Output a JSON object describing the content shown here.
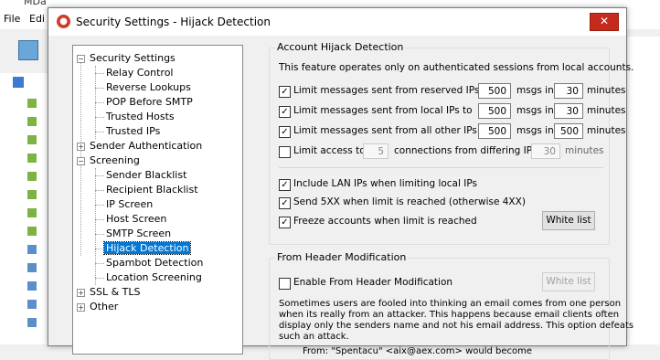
{
  "background": {
    "title": "MDa",
    "menu": [
      "File",
      "Edi"
    ]
  },
  "dialog": {
    "title": "Security Settings - Hijack Detection",
    "close_glyph": "✕"
  },
  "tree": {
    "security_settings": "Security Settings",
    "relay_control": "Relay Control",
    "reverse_lookups": "Reverse Lookups",
    "pop_before_smtp": "POP Before SMTP",
    "trusted_hosts": "Trusted Hosts",
    "trusted_ips": "Trusted IPs",
    "sender_auth": "Sender Authentication",
    "screening": "Screening",
    "sender_blacklist": "Sender Blacklist",
    "recipient_blacklist": "Recipient Blacklist",
    "ip_screen": "IP Screen",
    "host_screen": "Host Screen",
    "smtp_screen": "SMTP Screen",
    "hijack_detection": "Hijack Detection",
    "spambot_detection": "Spambot Detection",
    "location_screening": "Location Screening",
    "ssl_tls": "SSL & TLS",
    "other": "Other"
  },
  "account_hijack": {
    "title": "Account Hijack Detection",
    "description": "This feature operates only on authenticated sessions from local accounts.",
    "rows": [
      {
        "label": "Limit messages sent from reserved IPs to",
        "checked": "✓",
        "msgs": "500",
        "mid": "msgs in",
        "mins": "30",
        "unit": "minutes"
      },
      {
        "label": "Limit messages sent from local IPs to",
        "checked": "✓",
        "msgs": "500",
        "mid": "msgs in",
        "mins": "30",
        "unit": "minutes"
      },
      {
        "label": "Limit messages sent from all other IPs to",
        "checked": "✓",
        "msgs": "500",
        "mid": "msgs in",
        "mins": "500",
        "unit": "minutes"
      }
    ],
    "limit_access": {
      "label": "Limit access to",
      "checked": "",
      "count": "5",
      "mid": "connections from differing IPs in",
      "mins": "30",
      "unit": "minutes"
    },
    "include_lan": {
      "label": "Include LAN IPs when limiting local IPs",
      "checked": "✓"
    },
    "send_5xx": {
      "label": "Send 5XX when limit is reached (otherwise 4XX)",
      "checked": "✓"
    },
    "freeze": {
      "label": "Freeze accounts when limit is reached",
      "checked": "✓"
    },
    "white_list": "White list"
  },
  "from_header": {
    "title": "From Header Modification",
    "enable": {
      "label": "Enable From Header Modification",
      "checked": ""
    },
    "white_list": "White list",
    "paragraph": [
      "Sometimes users are fooled into thinking an email comes from one person",
      "when its really from an attacker. This happens because email clients often",
      "display only the senders name and not his email address. This option defeats",
      "such an attack."
    ],
    "cut_line": "From: \"Spentacu\" <aix@aex.com> would become"
  }
}
